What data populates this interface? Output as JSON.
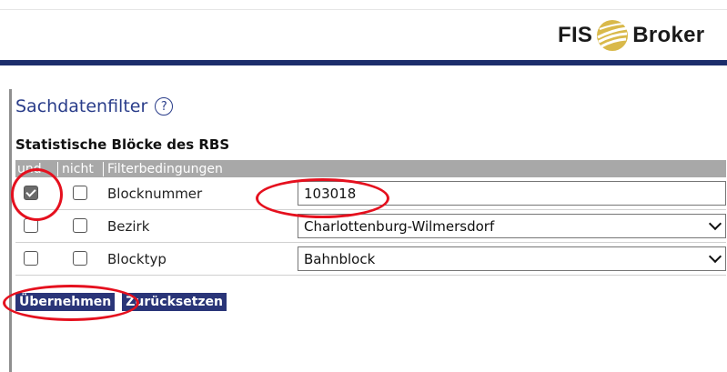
{
  "header": {
    "logo_left": "FIS",
    "logo_right": "Broker",
    "logo_icon": "fis-broker-globe-icon"
  },
  "filter": {
    "title": "Sachdatenfilter",
    "help_icon": "?",
    "section_title": "Statistische Blöcke des RBS",
    "columns": {
      "und": "und",
      "nicht": "nicht",
      "conditions": "Filterbedingungen"
    },
    "rows": [
      {
        "label": "Blocknummer",
        "und_checked": true,
        "nicht_checked": false,
        "value": "103018",
        "type": "text"
      },
      {
        "label": "Bezirk",
        "und_checked": false,
        "nicht_checked": false,
        "value": "Charlottenburg-Wilmersdorf",
        "type": "select"
      },
      {
        "label": "Blocktyp",
        "und_checked": false,
        "nicht_checked": false,
        "value": "Bahnblock",
        "type": "select"
      }
    ],
    "apply_label": "Übernehmen",
    "reset_label": "Zurücksetzen"
  },
  "colors": {
    "accent": "#2a3d8a",
    "header_bar": "#1c2d6b",
    "annotation": "#e5101e",
    "table_header": "#a8a8a8",
    "button": "#2a3578"
  }
}
